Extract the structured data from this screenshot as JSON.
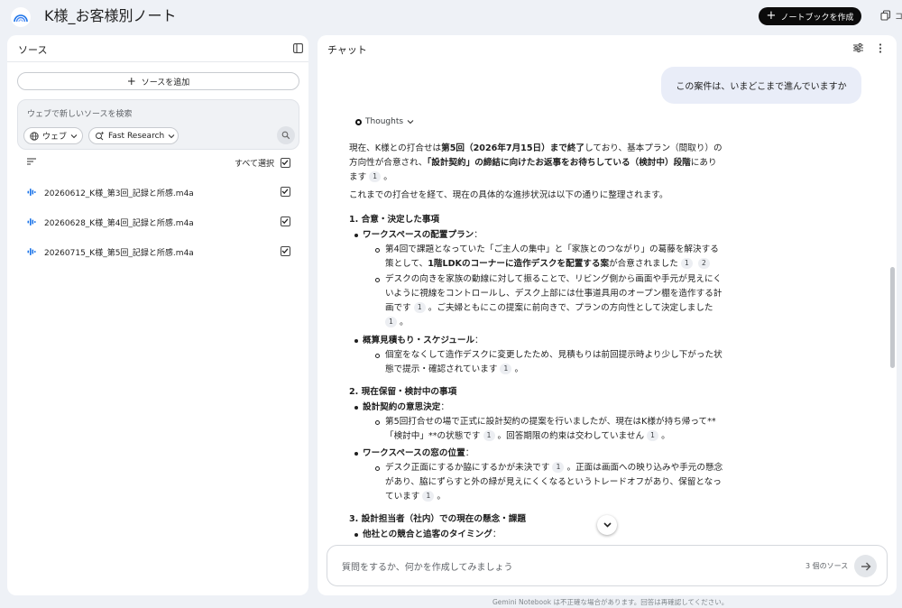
{
  "app": {
    "notebook_title": "K様_お客様別ノート",
    "create_notebook_label": "ノートブックを作成",
    "top_right_cut_text": "コ"
  },
  "sources_panel": {
    "title": "ソース",
    "add_source_label": "ソースを追加",
    "search_placeholder": "ウェブで新しいソースを検索",
    "web_chip_label": "ウェブ",
    "research_chip_label": "Fast Research",
    "select_all_label": "すべて選択",
    "select_all_checked": true,
    "sources": [
      {
        "name": "20260612_K様_第3回_記録と所感.m4a",
        "checked": true,
        "icon": "audio-icon"
      },
      {
        "name": "20260628_K様_第4回_記録と所感.m4a",
        "checked": true,
        "icon": "audio-icon"
      },
      {
        "name": "20260715_K様_第5回_記録と所感.m4a",
        "checked": true,
        "icon": "audio-icon"
      }
    ]
  },
  "chat_panel": {
    "title": "チャット",
    "user_message": "この案件は、いまどこまで進んでいますか",
    "thoughts_label": "Thoughts",
    "answer": {
      "intro_l1_a": "現在、K様との打合せは",
      "intro_l1_b": "第5回（2026年7月15日）まで終了",
      "intro_l1_c": "しており、基本プラン（間取り）の",
      "intro_l2_a": "方向性が合意され、",
      "intro_l2_b": "「設計契約」の締結に向けたお返事をお待ちしている（検討中）段階",
      "intro_l2_c": "にあり",
      "intro_l3": "ます",
      "summary": "これまでの打合せを経て、現在の具体的な進捗状況は以下の通りに整理されます。",
      "s1_heading": "1. 合意・決定した事項",
      "s1_b1_title": "ワークスペースの配置プラン",
      "s1_b1_a_l1": "第4回で課題となっていた「ご主人の集中」と「家族とのつながり」の葛藤を解決する",
      "s1_b1_a_l2a": "策として、",
      "s1_b1_a_l2b": "1階LDKのコーナーに造作デスクを配置する案",
      "s1_b1_a_l2c": "が合意されました",
      "s1_b1_b_l1": "デスクの向きを家族の動線に対して振ることで、リビング側から画面や手元が見えにく",
      "s1_b1_b_l2": "いように視線をコントロールし、デスク上部には仕事道具用のオープン棚を造作する計",
      "s1_b1_b_l3a": "画です",
      "s1_b1_b_l3b": "。ご夫婦ともにこの提案に前向きで、プランの方向性として決定しました",
      "s1_b2_title": "概算見積もり・スケジュール",
      "s1_b2_a_l1": "個室をなくして造作デスクに変更したため、見積もりは前回提示時より少し下がった状",
      "s1_b2_a_l2a": "態で提示・確認されています",
      "s1_b2_a_l2b": "。",
      "s2_heading": "2. 現在保留・検討中の事項",
      "s2_b1_title": "設計契約の意思決定",
      "s2_b1_a_l1": "第5回打合せの場で正式に設計契約の提案を行いましたが、現在はK様が持ち帰って**",
      "s2_b1_a_l2a": "「検討中」**の状態です",
      "s2_b1_a_l2b": "。回答期限の約束は交わしていません",
      "s2_b1_a_l2c": "。",
      "s2_b2_title": "ワークスペースの窓の位置",
      "s2_b2_a_l1a": "デスク正面にするか脇にするかが未決です",
      "s2_b2_a_l1b": "。正面は画面への映り込みや手元の懸念",
      "s2_b2_a_l2": "があり、脇にずらすと外の緑が見えにくくなるというトレードオフがあり、保留となっ",
      "s2_b2_a_l3a": "ています",
      "s2_b2_a_l3b": "。",
      "s3_heading": "3. 設計担当者（社内）での現在の懸念・課題",
      "s3_b1_title": "他社との競合と追客のタイミング",
      "colon": "："
    },
    "cite_1": "1",
    "cite_2": "2",
    "input_placeholder": "質問をするか、何かを作成してみましょう",
    "source_count": "3 個のソース"
  },
  "footer_note": "Gemini Notebook は不正確な場合があります。回答は再確認してください。"
}
